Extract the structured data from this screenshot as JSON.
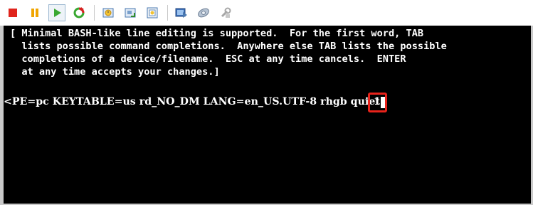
{
  "toolbar": {
    "buttons": [
      {
        "name": "stop-button",
        "icon": "stop-icon"
      },
      {
        "name": "pause-button",
        "icon": "pause-icon"
      },
      {
        "name": "play-button",
        "icon": "play-icon",
        "active": true
      },
      {
        "name": "reset-button",
        "icon": "reset-icon"
      },
      {
        "name": "snapshot-button",
        "icon": "snapshot-icon"
      },
      {
        "name": "revert-snapshot-button",
        "icon": "revert-snapshot-icon"
      },
      {
        "name": "snapshot-manager-button",
        "icon": "snapshot-manager-icon"
      },
      {
        "name": "console-view-button",
        "icon": "console-view-icon"
      },
      {
        "name": "settings-button",
        "icon": "settings-icon"
      },
      {
        "name": "tools-button",
        "icon": "tools-icon"
      }
    ],
    "colors": {
      "stop": "#e0241c",
      "pause": "#f0a500",
      "play": "#3aa832",
      "reset": "#d8201f"
    }
  },
  "terminal": {
    "help_lines": [
      "[ Minimal BASH-like line editing is supported.  For the first word, TAB",
      "  lists possible command completions.  Anywhere else TAB lists the possible",
      "  completions of a device/filename.  ESC at any time cancels.  ENTER",
      "  at any time accepts your changes.]"
    ],
    "command_line": "<PE=pc KEYTABLE=us rd_NO_DM LANG=en_US.UTF-8 rhgb quiet ",
    "typed_value": "1",
    "highlight_color": "#e8231b"
  }
}
